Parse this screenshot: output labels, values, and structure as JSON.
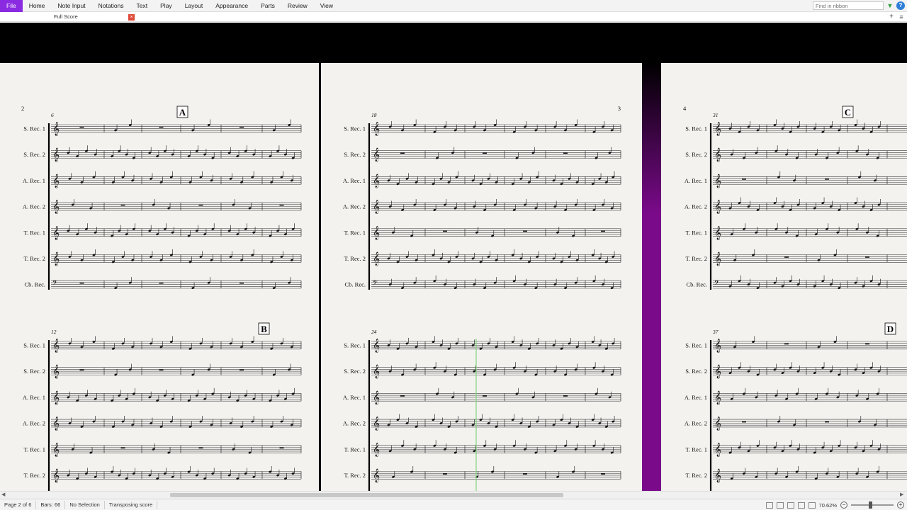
{
  "ribbon": {
    "tabs": [
      {
        "label": "File",
        "active": true
      },
      {
        "label": "Home",
        "active": false
      },
      {
        "label": "Note Input",
        "active": false
      },
      {
        "label": "Notations",
        "active": false
      },
      {
        "label": "Text",
        "active": false
      },
      {
        "label": "Play",
        "active": false
      },
      {
        "label": "Layout",
        "active": false
      },
      {
        "label": "Appearance",
        "active": false
      },
      {
        "label": "Parts",
        "active": false
      },
      {
        "label": "Review",
        "active": false
      },
      {
        "label": "View",
        "active": false
      }
    ],
    "search_placeholder": "Find in ribbon",
    "collapse_icon": "triangle-down-icon",
    "help_icon": "help-icon",
    "accent_color": "#8a2be2"
  },
  "tabs": {
    "current": "Full Score",
    "close_icon": "close-icon",
    "add_icon": "plus-icon",
    "menu_icon": "menu-icon"
  },
  "score": {
    "instruments": [
      "S. Rec. 1",
      "S. Rec. 2",
      "A. Rec. 1",
      "A. Rec. 2",
      "T. Rec. 1",
      "T. Rec. 2",
      "Cb. Rec."
    ],
    "pages": [
      {
        "number": "2",
        "systems": [
          {
            "start_bar": "6",
            "rehearsal": "A"
          },
          {
            "start_bar": "12",
            "rehearsal": "B"
          }
        ]
      },
      {
        "number": "3",
        "systems": [
          {
            "start_bar": "18",
            "rehearsal": ""
          },
          {
            "start_bar": "24",
            "rehearsal": ""
          }
        ]
      },
      {
        "number": "4",
        "systems": [
          {
            "start_bar": "31",
            "rehearsal": "C"
          },
          {
            "start_bar": "37",
            "rehearsal": "D"
          }
        ]
      }
    ],
    "paper_color": "#f4f2ef",
    "playback_line_color": "#7ed67e",
    "selection_gradient_color": "#7a0a8a"
  },
  "status": {
    "page": "Page 2 of 6",
    "bars": "Bars: 66",
    "selection": "No Selection",
    "transposing": "Transposing score",
    "zoom": "70.62%"
  }
}
